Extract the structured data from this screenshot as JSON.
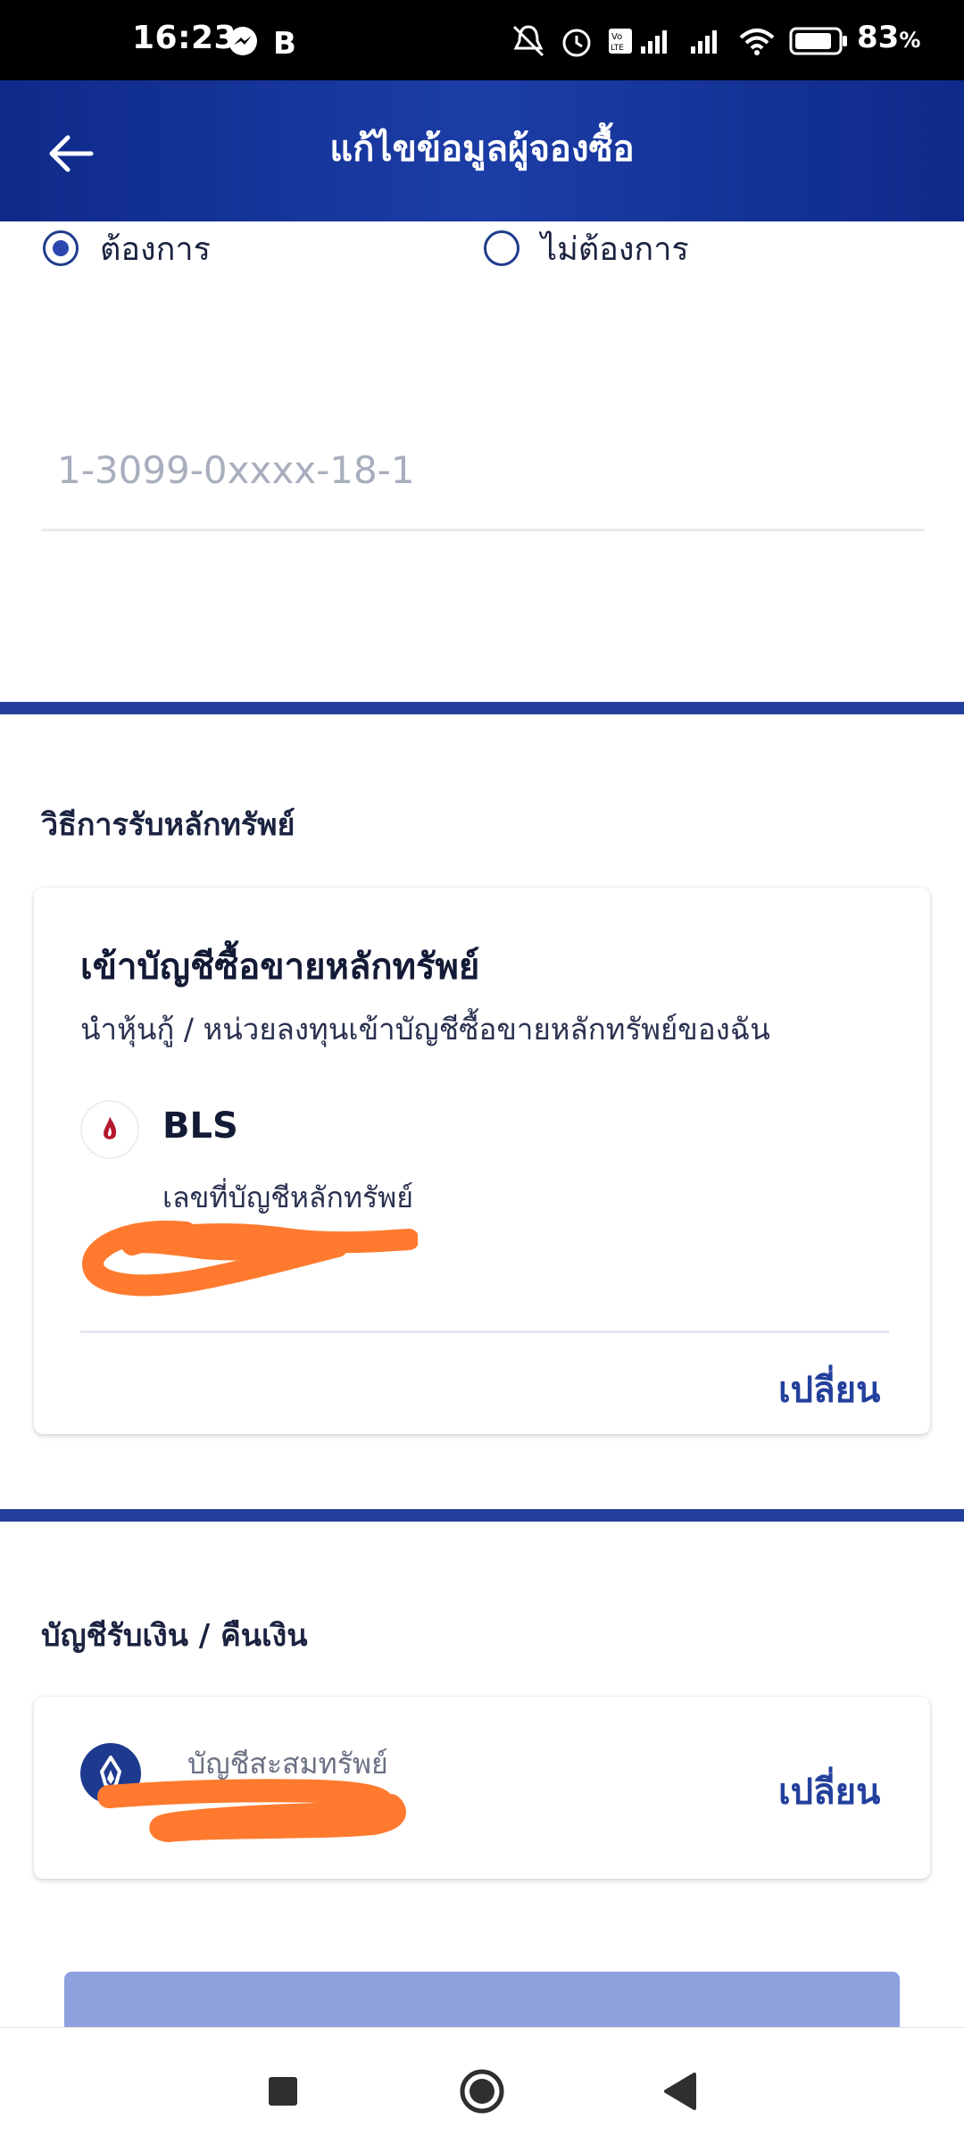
{
  "status_bar": {
    "time": "16:23",
    "battery_percent": "83",
    "battery_unit": "%",
    "icons": [
      "messenger-icon",
      "b-app-icon",
      "bell-muted-icon",
      "alarm-icon",
      "volte-icon",
      "signal-icon",
      "signal-icon",
      "wifi-icon",
      "battery-icon"
    ]
  },
  "header": {
    "title": "แก้ไขข้อมูลผู้จองซื้อ",
    "back_icon": "arrow-left-icon"
  },
  "radio": {
    "options": [
      {
        "label": "ต้องการ",
        "selected": true
      },
      {
        "label": "ไม่ต้องการ",
        "selected": false
      }
    ]
  },
  "id_field": {
    "value": "1-3099-0xxxx-18-1"
  },
  "securities_section": {
    "title": "วิธีการรับหลักทรัพย์",
    "card": {
      "title": "เข้าบัญชีซื้อขายหลักทรัพย์",
      "description": "นำหุ้นกู้ / หน่วยลงทุนเข้าบัญชีซื้อขายหลักทรัพย์ของฉัน",
      "broker": "BLS",
      "account_label": "เลขที่บัญชีหลักทรัพย์",
      "change_label": "เปลี่ยน"
    }
  },
  "refund_section": {
    "title": "บัญชีรับเงิน / คืนเงิน",
    "card": {
      "account_type": "บัญชีสะสมทรัพย์",
      "change_label": "เปลี่ยน"
    }
  },
  "colors": {
    "primary": "#1c3da6",
    "accent": "#23409c",
    "submit_disabled": "#8ea1df",
    "redaction": "#ff7a2e"
  }
}
